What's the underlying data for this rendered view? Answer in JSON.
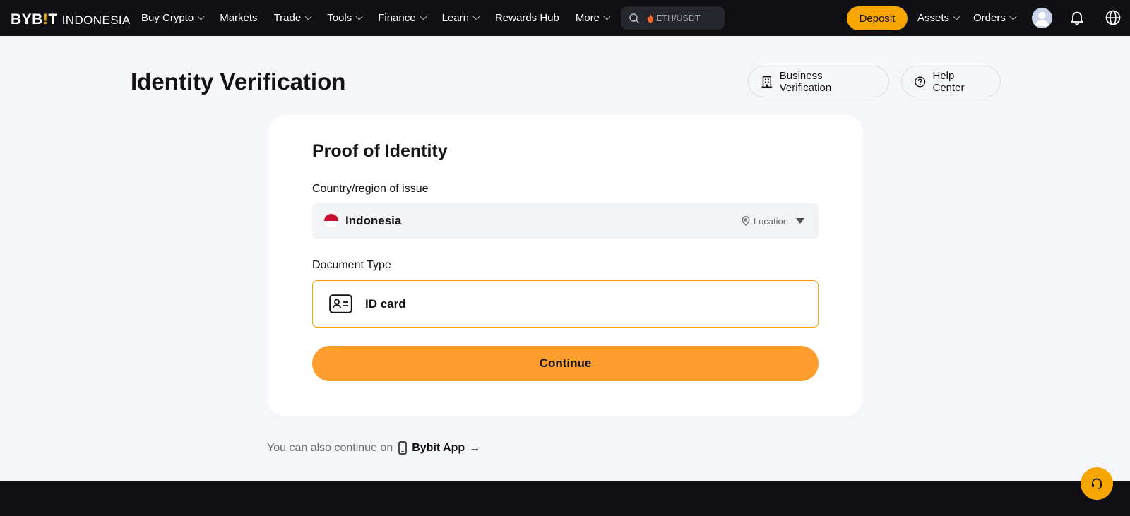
{
  "header": {
    "logo_brand_a": "BYB",
    "logo_brand_bang": "!",
    "logo_brand_b": "T",
    "logo_region": "INDONESIA",
    "nav": [
      {
        "label": "Buy Crypto",
        "dropdown": true
      },
      {
        "label": "Markets",
        "dropdown": false
      },
      {
        "label": "Trade",
        "dropdown": true
      },
      {
        "label": "Tools",
        "dropdown": true
      },
      {
        "label": "Finance",
        "dropdown": true
      },
      {
        "label": "Learn",
        "dropdown": true
      },
      {
        "label": "Rewards Hub",
        "dropdown": false
      },
      {
        "label": "More",
        "dropdown": true
      }
    ],
    "search_placeholder": "ETH/USDT",
    "deposit_label": "Deposit",
    "assets_label": "Assets",
    "orders_label": "Orders"
  },
  "page": {
    "title": "Identity Verification",
    "business_verification_label": "Business Verification",
    "help_center_label": "Help Center"
  },
  "card": {
    "title": "Proof of Identity",
    "country_label": "Country/region of issue",
    "country_value": "Indonesia",
    "location_label": "Location",
    "document_type_label": "Document Type",
    "document_option": "ID card",
    "continue_label": "Continue"
  },
  "app_prompt": {
    "text": "You can also continue on",
    "app_name": "Bybit App",
    "arrow": "→"
  },
  "colors": {
    "accent": "#f7a600",
    "continue_button": "#ff9c2e",
    "topbar": "#101014",
    "page_bg": "#f5f6fa",
    "flag_red": "#c8102e"
  },
  "icons": [
    "search-icon",
    "flame-icon",
    "avatar-icon",
    "bell-icon",
    "globe-icon",
    "building-icon",
    "help-icon",
    "indonesia-flag-icon",
    "location-pin-icon",
    "caret-down-icon",
    "id-card-icon",
    "phone-icon",
    "headset-icon"
  ]
}
